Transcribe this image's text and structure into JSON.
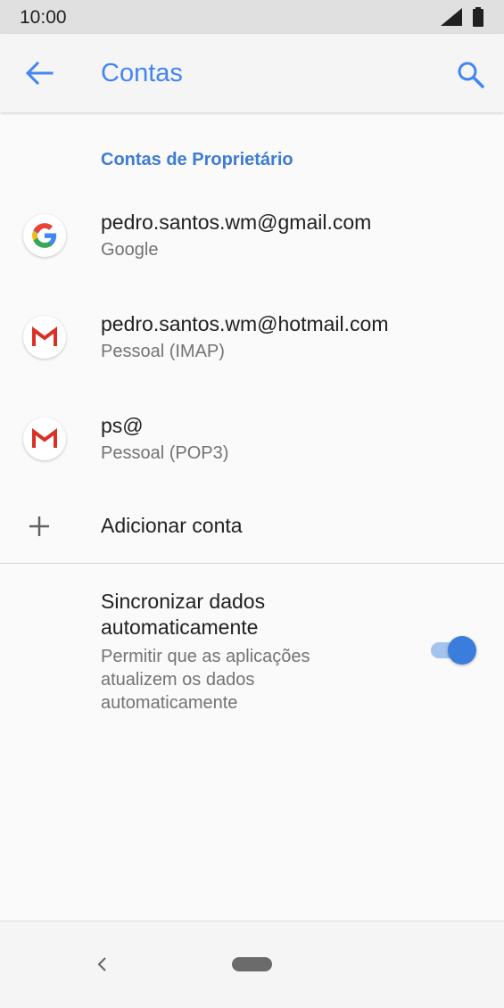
{
  "status_bar": {
    "time": "10:00"
  },
  "header": {
    "title": "Contas"
  },
  "section": {
    "title": "Contas de Proprietário"
  },
  "accounts": [
    {
      "primary": "pedro.santos.wm@gmail.com",
      "secondary": "Google",
      "icon": "google-icon"
    },
    {
      "primary": "pedro.santos.wm@hotmail.com",
      "secondary": "Pessoal (IMAP)",
      "icon": "gmail-icon"
    },
    {
      "primary": "ps@",
      "secondary": "Pessoal (POP3)",
      "icon": "gmail-icon"
    }
  ],
  "add_account": {
    "label": "Adicionar conta",
    "icon": "plus-icon"
  },
  "sync": {
    "title": "Sincronizar dados automaticamente",
    "summary": "Permitir que as aplicações atualizem os dados automaticamente",
    "enabled": true
  },
  "colors": {
    "accent": "#4285f4",
    "toggle_thumb": "#3b7ddd",
    "toggle_track": "#a5c3ef",
    "gmail_red": "#d93025"
  }
}
